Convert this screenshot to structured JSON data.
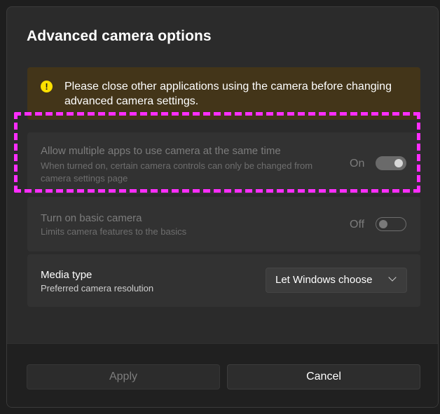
{
  "dialog": {
    "title": "Advanced camera options"
  },
  "banner": {
    "icon": "warning-icon",
    "icon_glyph": "!",
    "text": "Please close other applications using the camera before changing advanced camera settings."
  },
  "settings": [
    {
      "title": "Allow multiple apps to use camera at the same time",
      "subtitle": "When turned on, certain camera controls can only be changed from camera settings page",
      "state_label": "On",
      "toggle_on": true,
      "disabled": true
    },
    {
      "title": "Turn on basic camera",
      "subtitle": "Limits camera features to the basics",
      "state_label": "Off",
      "toggle_on": false,
      "disabled": true
    },
    {
      "title": "Media type",
      "subtitle": "Preferred camera resolution",
      "selected_option": "Let Windows choose",
      "disabled": false
    }
  ],
  "buttons": {
    "apply_label": "Apply",
    "cancel_label": "Cancel"
  },
  "colors": {
    "highlight": "#ff2dff",
    "warning": "#fce100",
    "banner_bg": "#433519"
  }
}
